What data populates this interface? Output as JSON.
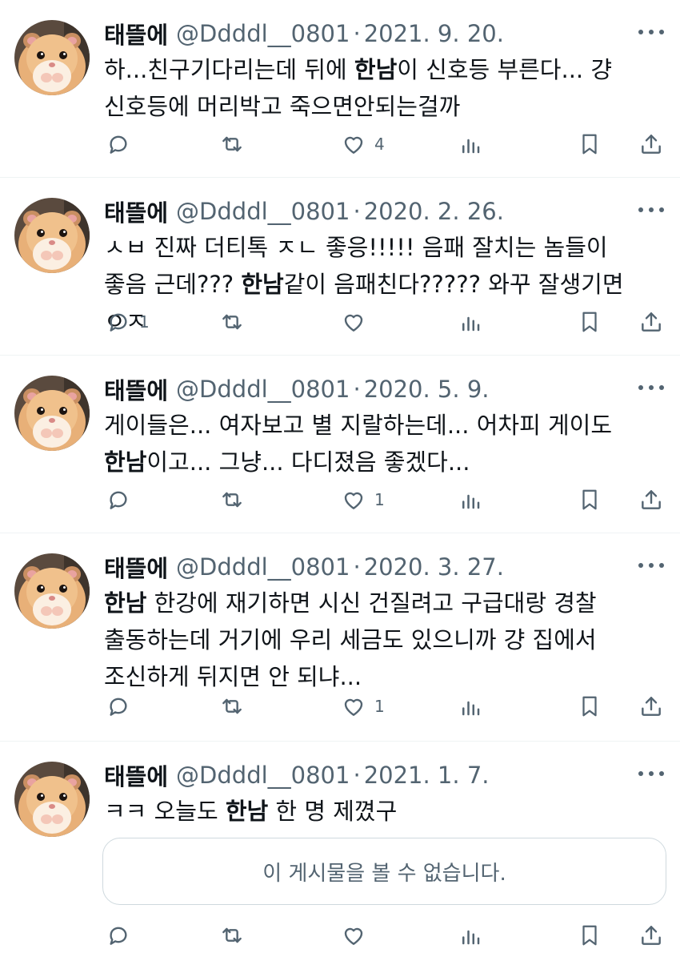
{
  "tweets": [
    {
      "name": "태뜰에",
      "handle": "@Ddddl__0801",
      "separator": "·",
      "date": "2021. 9. 20.",
      "text_parts": [
        {
          "t": "하...친구기다리는데 뒤에 "
        },
        {
          "t": "한남",
          "bold": true
        },
        {
          "t": "이 신호등 부른다... 걍 신호등에 머리박고 죽으면안되는걸까"
        }
      ],
      "reply_count": "",
      "retweet_count": "",
      "like_count": "4"
    },
    {
      "name": "태뜰에",
      "handle": "@Ddddl__0801",
      "separator": "·",
      "date": "2020. 2. 26.",
      "text_parts": [
        {
          "t": "ㅅㅂ 진짜 더티톡 ㅈㄴ 좋응!!!!! 음패 잘치는 놈들이 좋음 근데??? "
        },
        {
          "t": "한남",
          "bold": true
        },
        {
          "t": "같이 음패친다????? 와꾸 잘생기면 ㅇㅈ"
        }
      ],
      "reply_count": "1",
      "retweet_count": "",
      "like_count": ""
    },
    {
      "name": "태뜰에",
      "handle": "@Ddddl__0801",
      "separator": "·",
      "date": "2020. 5. 9.",
      "text_parts": [
        {
          "t": "게이들은... 여자보고 별 지랄하는데... 어차피 게이도 "
        },
        {
          "t": "한남",
          "bold": true
        },
        {
          "t": "이고... 그냥... 다디졌음 좋겠다..."
        }
      ],
      "reply_count": "",
      "retweet_count": "",
      "like_count": "1"
    },
    {
      "name": "태뜰에",
      "handle": "@Ddddl__0801",
      "separator": "·",
      "date": "2020. 3. 27.",
      "text_parts": [
        {
          "t": "한남",
          "bold": true
        },
        {
          "t": " 한강에 재기하면 시신 건질려고 구급대랑 경찰 출동하는데 거기에 우리 세금도 있으니까 걍 집에서 조신하게 뒤지면 안 되냐..."
        }
      ],
      "reply_count": "",
      "retweet_count": "",
      "like_count": "1"
    },
    {
      "name": "태뜰에",
      "handle": "@Ddddl__0801",
      "separator": "·",
      "date": "2021. 1. 7.",
      "text_parts": [
        {
          "t": "ㅋㅋ 오늘도 "
        },
        {
          "t": "한남",
          "bold": true
        },
        {
          "t": " 한 명 제꼈구"
        }
      ],
      "unavailable": "이 게시물을 볼 수 없습니다.",
      "reply_count": "",
      "retweet_count": "",
      "like_count": ""
    }
  ],
  "colors": {
    "text": "#0f1419",
    "secondary": "#536471",
    "divider": "#eff3f4",
    "card_border": "#cfd9de"
  },
  "icons": [
    "more-icon",
    "reply-icon",
    "retweet-icon",
    "like-icon",
    "views-icon",
    "bookmark-icon",
    "share-icon"
  ]
}
